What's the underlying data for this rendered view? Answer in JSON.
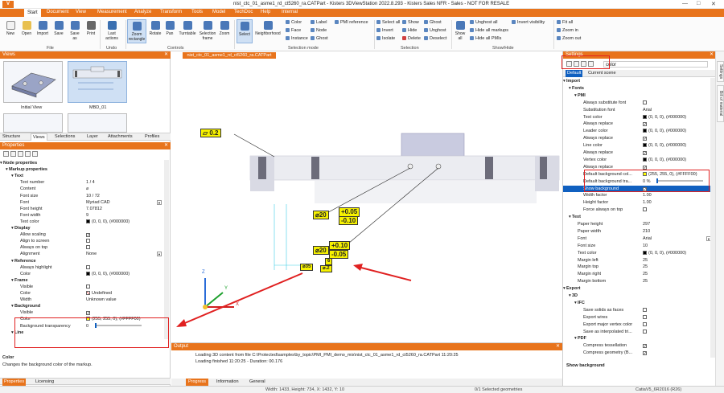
{
  "window": {
    "logo": "V",
    "title": "nist_ctc_01_asme1_rd_ct5260_ra.CATPart - Kisters 3DViewStation 2022.8.293 - Kisters Sales NFR - Sales - NOT FOR RESALE",
    "minimize": "—",
    "maximize": "□",
    "close": "✕"
  },
  "menu": {
    "items": [
      "Start",
      "Document",
      "View",
      "Measurement",
      "Analyze",
      "Transform",
      "Tools",
      "Model",
      "TechDoc",
      "Help",
      "Internal"
    ]
  },
  "ribbon": {
    "file_buttons": [
      "New",
      "Open",
      "Import",
      "Save",
      "Save as",
      "Print"
    ],
    "file_group": "File",
    "undo_button": "Last actions",
    "undo_group": "Undo",
    "control_buttons": [
      "Zoom rectangle",
      "Rotate",
      "Pan",
      "Turntable",
      "Selection frame",
      "Zoom"
    ],
    "controls_group": "Controls",
    "selection_buttons": [
      "Select",
      "Neighborhood"
    ],
    "selection_mode_items": [
      "Color",
      "Face",
      "Instance",
      "Label",
      "Node",
      "Ghost",
      "PMI reference"
    ],
    "selection_mode_group": "Selection mode",
    "selection_items": [
      "Select all",
      "Invert",
      "Isolate",
      "Show",
      "Hide",
      "Delete",
      "Ghost",
      "Unghost",
      "Deselect"
    ],
    "selection_group": "Selection",
    "show_all": "Show all",
    "showhide_items": [
      "Unghost all",
      "Hide all markups",
      "Hide all PMIs",
      "Invert visibility"
    ],
    "showhide_group": "Show/Hide",
    "zoom_items": [
      "Fit all",
      "Zoom in",
      "Zoom out"
    ]
  },
  "views_panel": {
    "title": "Views",
    "thumbnails": [
      "Initial View",
      "MBD_01"
    ],
    "tabs": [
      "Structure",
      "Views",
      "Selections",
      "Layer",
      "Attachments",
      "Profiles"
    ]
  },
  "properties_panel": {
    "title": "Properties",
    "rows": [
      {
        "label": "Node properties",
        "value": "",
        "type": "section",
        "indent": 0
      },
      {
        "label": "Markup properties",
        "value": "",
        "type": "section",
        "indent": 1
      },
      {
        "label": "Text",
        "value": "",
        "type": "section",
        "indent": 2
      },
      {
        "label": "Text number",
        "value": "1 / 4",
        "type": "text",
        "indent": 3
      },
      {
        "label": "Content",
        "value": "⌀",
        "type": "text",
        "indent": 3
      },
      {
        "label": "Font size",
        "value": "10 / 72",
        "type": "text",
        "indent": 3
      },
      {
        "label": "Font",
        "value": "Myriad CAD",
        "type": "dropdown",
        "indent": 3
      },
      {
        "label": "Font height",
        "value": "7.07812",
        "type": "text",
        "indent": 3
      },
      {
        "label": "Font width",
        "value": "9",
        "type": "text",
        "indent": 3
      },
      {
        "label": "Text color",
        "value": "(0, 0, 0), (#000000)",
        "type": "color",
        "color": "#000000",
        "indent": 3
      },
      {
        "label": "Display",
        "value": "",
        "type": "section",
        "indent": 2
      },
      {
        "label": "Allow scaling",
        "value": "",
        "type": "check",
        "checked": true,
        "indent": 3
      },
      {
        "label": "Align to screen",
        "value": "",
        "type": "check",
        "checked": false,
        "indent": 3
      },
      {
        "label": "Always on top",
        "value": "",
        "type": "check",
        "checked": false,
        "indent": 3
      },
      {
        "label": "Alignment",
        "value": "None",
        "type": "dropdown",
        "indent": 3
      },
      {
        "label": "Reference",
        "value": "",
        "type": "section",
        "indent": 2
      },
      {
        "label": "Always highlight",
        "value": "",
        "type": "check",
        "checked": false,
        "indent": 3
      },
      {
        "label": "Color",
        "value": "(0, 0, 0), (#000000)",
        "type": "color",
        "color": "#000000",
        "indent": 3
      },
      {
        "label": "Frame",
        "value": "",
        "type": "section",
        "indent": 2
      },
      {
        "label": "Visible",
        "value": "",
        "type": "check",
        "checked": false,
        "indent": 3
      },
      {
        "label": "Color",
        "value": "Undefined",
        "type": "undefined",
        "indent": 3
      },
      {
        "label": "Width",
        "value": "Unknown value",
        "type": "text",
        "indent": 3
      },
      {
        "label": "Background",
        "value": "",
        "type": "section",
        "indent": 2
      },
      {
        "label": "Visible",
        "value": "",
        "type": "check",
        "checked": true,
        "indent": 3
      },
      {
        "label": "Color",
        "value": "(255, 255, 0), (#FFFF00)",
        "type": "color",
        "color": "#ffff00",
        "indent": 3
      },
      {
        "label": "Background transparency",
        "value": "0",
        "type": "slider",
        "indent": 3
      },
      {
        "label": "Line",
        "value": "",
        "type": "section",
        "indent": 2
      }
    ],
    "description_title": "Color",
    "description_text": "Changes the background color of the markup.",
    "bottom_tabs": [
      "Properties",
      "Licensing"
    ]
  },
  "viewport": {
    "tab": "nist_ctc_01_asme1_rd_ct5260_ra.CATPart",
    "pmi_labels": {
      "flat": "▱ 0.2",
      "d1_main": "⌀20",
      "d1_tol_top": "+0.05",
      "d1_tol_bot": "-0.10",
      "d2_main": "⌀20",
      "d2_tol_top": "+0.10",
      "d2_tol_bot": "-0.05",
      "d3_tag": "6",
      "d3_main": "⌀35",
      "d3_tol": "⌀.2"
    },
    "axis_labels": {
      "x": "X",
      "y": "Y",
      "z": "Z"
    }
  },
  "output_panel": {
    "title": "Output",
    "lines": [
      "Loading 3D content from file C:\\Protected\\samples\\by_topic\\PMI_PMI_demo_mix\\nist_ctc_01_asme1_rd_ct5260_ra.CATPart 11:20:25",
      "Loading finished 11:20:25 - Duration: 00.176"
    ],
    "tabs": [
      "Progress",
      "Information",
      "General"
    ]
  },
  "status_bar": {
    "dimensions": "Width: 1433, Height: 734, X: 1432, Y: 10",
    "selection": "0/1 Selected geometries",
    "version": "CatiaV5_6R2016 (R26)"
  },
  "settings_panel": {
    "title": "Settings",
    "search_value": "color",
    "tabs": [
      "Default",
      "Current scene"
    ],
    "rows": [
      {
        "label": "Import",
        "value": "",
        "type": "section",
        "indent": 0
      },
      {
        "label": "Fonts",
        "value": "",
        "type": "section",
        "indent": 1
      },
      {
        "label": "PMI",
        "value": "",
        "type": "section",
        "indent": 2
      },
      {
        "label": "Always substitute font",
        "value": "",
        "type": "check",
        "checked": false,
        "indent": 3
      },
      {
        "label": "Substitution font",
        "value": "Arial",
        "type": "text",
        "indent": 3
      },
      {
        "label": "Text color",
        "value": "(0, 0, 0), (#000000)",
        "type": "color",
        "color": "#000000",
        "indent": 3
      },
      {
        "label": "Always replace",
        "value": "",
        "type": "check",
        "checked": true,
        "indent": 3
      },
      {
        "label": "Leader color",
        "value": "(0, 0, 0), (#000000)",
        "type": "color",
        "color": "#000000",
        "indent": 3
      },
      {
        "label": "Always replace",
        "value": "",
        "type": "check",
        "checked": true,
        "indent": 3
      },
      {
        "label": "Line color",
        "value": "(0, 0, 0), (#000000)",
        "type": "color",
        "color": "#000000",
        "indent": 3
      },
      {
        "label": "Always replace",
        "value": "",
        "type": "check",
        "checked": true,
        "indent": 3
      },
      {
        "label": "Vertex color",
        "value": "(0, 0, 0), (#000000)",
        "type": "color",
        "color": "#000000",
        "indent": 3
      },
      {
        "label": "Always replace",
        "value": "",
        "type": "check",
        "checked": true,
        "indent": 3
      },
      {
        "label": "Default background col...",
        "value": "(255, 255, 0), (#FFFF00)",
        "type": "color",
        "color": "#ffff00",
        "indent": 3
      },
      {
        "label": "Default background tra...",
        "value": "0 %",
        "type": "slider",
        "indent": 3
      },
      {
        "label": "Show background",
        "value": "",
        "type": "check",
        "checked": true,
        "indent": 3,
        "highlight": true
      },
      {
        "label": "Width factor",
        "value": "1.00",
        "type": "text",
        "indent": 3
      },
      {
        "label": "Height factor",
        "value": "1.00",
        "type": "text",
        "indent": 3
      },
      {
        "label": "Force always on top",
        "value": "",
        "type": "check",
        "checked": false,
        "indent": 3
      },
      {
        "label": "Text",
        "value": "",
        "type": "section",
        "indent": 1
      },
      {
        "label": "Paper height",
        "value": "297",
        "type": "text",
        "indent": 2
      },
      {
        "label": "Paper width",
        "value": "210",
        "type": "text",
        "indent": 2
      },
      {
        "label": "Font",
        "value": "Arial",
        "type": "dropdown",
        "indent": 2
      },
      {
        "label": "Font size",
        "value": "10",
        "type": "text",
        "indent": 2
      },
      {
        "label": "Text color",
        "value": "(0, 0, 0), (#000000)",
        "type": "color",
        "color": "#000000",
        "indent": 2
      },
      {
        "label": "Margin left",
        "value": "25",
        "type": "text",
        "indent": 2
      },
      {
        "label": "Margin top",
        "value": "25",
        "type": "text",
        "indent": 2
      },
      {
        "label": "Margin right",
        "value": "25",
        "type": "text",
        "indent": 2
      },
      {
        "label": "Margin bottom",
        "value": "25",
        "type": "text",
        "indent": 2
      },
      {
        "label": "Export",
        "value": "",
        "type": "section",
        "indent": 0
      },
      {
        "label": "3D",
        "value": "",
        "type": "section",
        "indent": 1
      },
      {
        "label": "IFC",
        "value": "",
        "type": "section",
        "indent": 2
      },
      {
        "label": "Save solids as faces",
        "value": "",
        "type": "check",
        "checked": false,
        "indent": 3
      },
      {
        "label": "Export wires",
        "value": "",
        "type": "check",
        "checked": false,
        "indent": 3
      },
      {
        "label": "Export major vertex color",
        "value": "",
        "type": "check",
        "checked": false,
        "indent": 3
      },
      {
        "label": "Save as interpolated tri...",
        "value": "",
        "type": "check",
        "checked": false,
        "indent": 3
      },
      {
        "label": "PDF",
        "value": "",
        "type": "section",
        "indent": 2
      },
      {
        "label": "Compress tessellation",
        "value": "",
        "type": "check",
        "checked": true,
        "indent": 3
      },
      {
        "label": "Compress geometry (B...",
        "value": "",
        "type": "check",
        "checked": true,
        "indent": 3
      }
    ],
    "description_title": "Show background"
  },
  "side_tabs": [
    "Settings",
    "Bill of material"
  ],
  "colors": {
    "accent": "#e8741c",
    "highlight": "#1060c0",
    "annotation": "#e02020",
    "pmi": "#f7f200"
  }
}
